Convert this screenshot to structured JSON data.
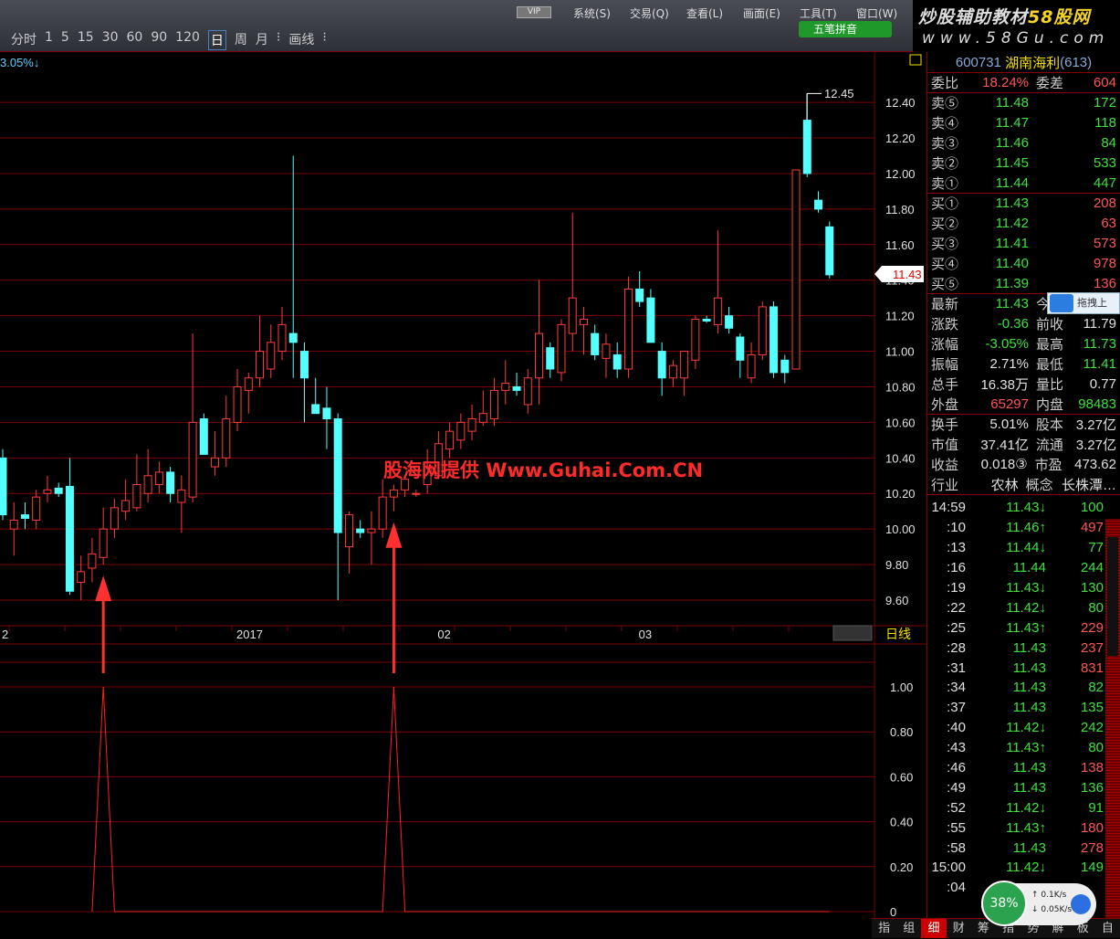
{
  "menu": {
    "vip": "VIP",
    "items": [
      "系统(S)",
      "交易(Q)",
      "查看(L)",
      "画面(E)",
      "工具(T)",
      "窗口(W)"
    ],
    "ime": "五笔拼音"
  },
  "periods": [
    "分时",
    "1",
    "5",
    "15",
    "30",
    "60",
    "90",
    "120",
    "日",
    "周",
    "月",
    "⁝",
    "画线",
    "⁝"
  ],
  "selected_period": "日",
  "logo": {
    "line1a": "炒股辅助教材",
    "line1b": "58股网",
    "line2": "www.58Gu.com"
  },
  "chart": {
    "change_label": "3.05%↓",
    "watermark": "股海网提供 Www.Guhai.Com.CN",
    "high_label": "12.45",
    "current_price": "11.43",
    "period_label": "日线"
  },
  "chart_data": {
    "type": "candlestick",
    "price_ticks": [
      "12.40",
      "12.20",
      "12.00",
      "11.80",
      "11.60",
      "11.40",
      "11.20",
      "11.00",
      "10.80",
      "10.60",
      "10.40",
      "10.20",
      "10.00",
      "9.80",
      "9.60"
    ],
    "ylim": [
      9.6,
      12.4
    ],
    "date_labels": [
      {
        "i": 0,
        "t": "2"
      },
      {
        "i": 21,
        "t": "2017"
      },
      {
        "i": 39,
        "t": "02"
      },
      {
        "i": 57,
        "t": "03"
      }
    ],
    "ohlc": [
      [
        10.4,
        10.45,
        10.05,
        10.08
      ],
      [
        10.0,
        10.15,
        9.85,
        10.05
      ],
      [
        10.08,
        10.15,
        10.0,
        10.06
      ],
      [
        10.05,
        10.22,
        10.0,
        10.18
      ],
      [
        10.2,
        10.3,
        10.15,
        10.22
      ],
      [
        10.23,
        10.26,
        10.18,
        10.2
      ],
      [
        10.24,
        10.4,
        9.63,
        9.65
      ],
      [
        9.7,
        9.85,
        9.6,
        9.76
      ],
      [
        9.78,
        9.95,
        9.7,
        9.86
      ],
      [
        9.84,
        10.12,
        9.8,
        10.0
      ],
      [
        10.0,
        10.17,
        9.95,
        10.12
      ],
      [
        10.1,
        10.28,
        10.05,
        10.16
      ],
      [
        10.12,
        10.42,
        10.1,
        10.25
      ],
      [
        10.2,
        10.45,
        10.15,
        10.3
      ],
      [
        10.25,
        10.38,
        10.2,
        10.32
      ],
      [
        10.32,
        10.35,
        10.15,
        10.2
      ],
      [
        10.15,
        10.3,
        9.98,
        10.22
      ],
      [
        10.18,
        11.1,
        10.15,
        10.6
      ],
      [
        10.62,
        10.65,
        10.42,
        10.42
      ],
      [
        10.35,
        10.55,
        10.3,
        10.4
      ],
      [
        10.4,
        10.75,
        10.35,
        10.62
      ],
      [
        10.6,
        10.9,
        10.55,
        10.8
      ],
      [
        10.78,
        10.88,
        10.65,
        10.85
      ],
      [
        10.85,
        11.2,
        10.8,
        11.0
      ],
      [
        10.9,
        11.15,
        10.85,
        11.05
      ],
      [
        11.0,
        11.25,
        10.95,
        11.15
      ],
      [
        11.1,
        12.1,
        10.85,
        11.05
      ],
      [
        11.0,
        11.05,
        10.6,
        10.85
      ],
      [
        10.7,
        10.85,
        10.65,
        10.65
      ],
      [
        10.68,
        10.8,
        10.45,
        10.62
      ],
      [
        10.62,
        10.65,
        9.6,
        9.98
      ],
      [
        9.9,
        10.1,
        9.75,
        10.08
      ],
      [
        10.0,
        10.05,
        9.95,
        9.98
      ],
      [
        9.98,
        10.1,
        9.8,
        10.0
      ],
      [
        10.0,
        10.28,
        9.95,
        10.18
      ],
      [
        10.18,
        10.25,
        10.1,
        10.22
      ],
      [
        10.22,
        10.3,
        10.18,
        10.28
      ],
      [
        10.2,
        10.22,
        10.18,
        10.2
      ],
      [
        10.25,
        10.45,
        10.2,
        10.35
      ],
      [
        10.3,
        10.55,
        10.28,
        10.48
      ],
      [
        10.45,
        10.6,
        10.4,
        10.55
      ],
      [
        10.5,
        10.65,
        10.45,
        10.6
      ],
      [
        10.55,
        10.7,
        10.5,
        10.62
      ],
      [
        10.6,
        10.78,
        10.58,
        10.65
      ],
      [
        10.62,
        10.85,
        10.58,
        10.78
      ],
      [
        10.78,
        10.95,
        10.7,
        10.82
      ],
      [
        10.8,
        10.88,
        10.75,
        10.78
      ],
      [
        10.7,
        10.9,
        10.65,
        10.85
      ],
      [
        10.85,
        11.4,
        10.7,
        11.1
      ],
      [
        11.02,
        11.05,
        10.85,
        10.9
      ],
      [
        10.88,
        11.18,
        10.83,
        11.15
      ],
      [
        11.1,
        11.78,
        11.0,
        11.3
      ],
      [
        11.15,
        11.25,
        10.98,
        11.18
      ],
      [
        11.1,
        11.15,
        10.95,
        10.98
      ],
      [
        10.96,
        11.1,
        10.85,
        11.04
      ],
      [
        10.98,
        11.05,
        10.85,
        10.9
      ],
      [
        10.9,
        11.42,
        10.85,
        11.35
      ],
      [
        11.35,
        11.45,
        11.25,
        11.28
      ],
      [
        11.3,
        11.35,
        11.05,
        11.05
      ],
      [
        11.0,
        11.05,
        10.75,
        10.85
      ],
      [
        10.85,
        10.95,
        10.8,
        10.92
      ],
      [
        10.85,
        11.0,
        10.75,
        11.0
      ],
      [
        10.95,
        11.2,
        10.9,
        11.18
      ],
      [
        11.18,
        11.2,
        11.16,
        11.17
      ],
      [
        11.15,
        11.68,
        11.1,
        11.3
      ],
      [
        11.2,
        11.25,
        11.1,
        11.13
      ],
      [
        11.08,
        11.1,
        10.85,
        10.95
      ],
      [
        10.85,
        11.05,
        10.82,
        10.98
      ],
      [
        10.98,
        11.28,
        10.95,
        11.25
      ],
      [
        11.25,
        11.28,
        10.85,
        10.88
      ],
      [
        10.95,
        10.98,
        10.82,
        10.88
      ],
      [
        10.9,
        12.02,
        10.9,
        12.02
      ],
      [
        12.3,
        12.45,
        11.98,
        12.0
      ],
      [
        11.85,
        11.9,
        11.78,
        11.8
      ],
      [
        11.7,
        11.73,
        11.41,
        11.43
      ]
    ],
    "signal_ticks": [
      "1.00",
      "0.80",
      "0.60",
      "0.40",
      "0.20",
      "0"
    ],
    "signal_ylim": [
      0,
      1
    ],
    "signal_spikes": [
      9,
      35
    ],
    "signal_start": 8,
    "colors": {
      "up": "#ff3b3b",
      "down": "#54ffff",
      "grid": "#7a0000",
      "signal": "#ff2020"
    }
  },
  "quote": {
    "code": "600731",
    "name": "湖南海利",
    "count": "(613)",
    "wb_label": "委比",
    "wb": "18.24%",
    "wc_label": "委差",
    "wc": "604",
    "sells": [
      {
        "l": "卖⑤",
        "p": "11.48",
        "v": "172"
      },
      {
        "l": "卖④",
        "p": "11.47",
        "v": "118"
      },
      {
        "l": "卖③",
        "p": "11.46",
        "v": "84"
      },
      {
        "l": "卖②",
        "p": "11.45",
        "v": "533"
      },
      {
        "l": "卖①",
        "p": "11.44",
        "v": "447"
      }
    ],
    "buys": [
      {
        "l": "买①",
        "p": "11.43",
        "v": "208"
      },
      {
        "l": "买②",
        "p": "11.42",
        "v": "63"
      },
      {
        "l": "买③",
        "p": "11.41",
        "v": "573"
      },
      {
        "l": "买④",
        "p": "11.40",
        "v": "978"
      },
      {
        "l": "买⑤",
        "p": "11.39",
        "v": "136"
      }
    ],
    "stats1": [
      [
        "最新",
        "11.43",
        "今开",
        ""
      ],
      [
        "涨跌",
        "-0.36",
        "前收",
        "11.79"
      ],
      [
        "涨幅",
        "-3.05%",
        "最高",
        "11.73"
      ],
      [
        "振幅",
        "2.71%",
        "最低",
        "11.41"
      ],
      [
        "总手",
        "16.38万",
        "量比",
        "0.77"
      ],
      [
        "外盘",
        "65297",
        "内盘",
        "98483"
      ]
    ],
    "stats2": [
      [
        "换手",
        "5.01%",
        "股本",
        "3.27亿"
      ],
      [
        "市值",
        "37.41亿",
        "流通",
        "3.27亿"
      ],
      [
        "收益",
        "0.018③",
        "市盈",
        "473.62"
      ],
      [
        "行业",
        "农林",
        "概念",
        "长株潭…"
      ]
    ]
  },
  "ticks": [
    [
      "14:59",
      "11.43↓",
      "100"
    ],
    [
      ":10",
      "11.46↑",
      "497"
    ],
    [
      ":13",
      "11.44↓",
      "77"
    ],
    [
      ":16",
      "11.44",
      "244"
    ],
    [
      ":19",
      "11.43↓",
      "130"
    ],
    [
      ":22",
      "11.42↓",
      "80"
    ],
    [
      ":25",
      "11.43↑",
      "229"
    ],
    [
      ":28",
      "11.43",
      "237"
    ],
    [
      ":31",
      "11.43",
      "831"
    ],
    [
      ":34",
      "11.43",
      "82"
    ],
    [
      ":37",
      "11.43",
      "135"
    ],
    [
      ":40",
      "11.42↓",
      "242"
    ],
    [
      ":43",
      "11.43↑",
      "80"
    ],
    [
      ":46",
      "11.43",
      "138"
    ],
    [
      ":49",
      "11.43",
      "136"
    ],
    [
      ":52",
      "11.42↓",
      "91"
    ],
    [
      ":55",
      "11.43↑",
      "180"
    ],
    [
      ":58",
      "11.43",
      "278"
    ],
    [
      "15:00",
      "11.42↓",
      "149"
    ],
    [
      ":04",
      "",
      ""
    ]
  ],
  "tick_colors": [
    "g",
    "r",
    "g",
    "g",
    "g",
    "g",
    "r",
    "r",
    "r",
    "g",
    "g",
    "g",
    "g",
    "r",
    "g",
    "g",
    "r",
    "r",
    "g",
    "g"
  ],
  "tabs": [
    "指",
    "组",
    "细",
    "财",
    "筹",
    "指",
    "势",
    "解",
    "板",
    "自"
  ],
  "net": {
    "percent": "38%",
    "up": "0.1K/s",
    "down": "0.05K/s"
  },
  "baidu": "拖拽上"
}
